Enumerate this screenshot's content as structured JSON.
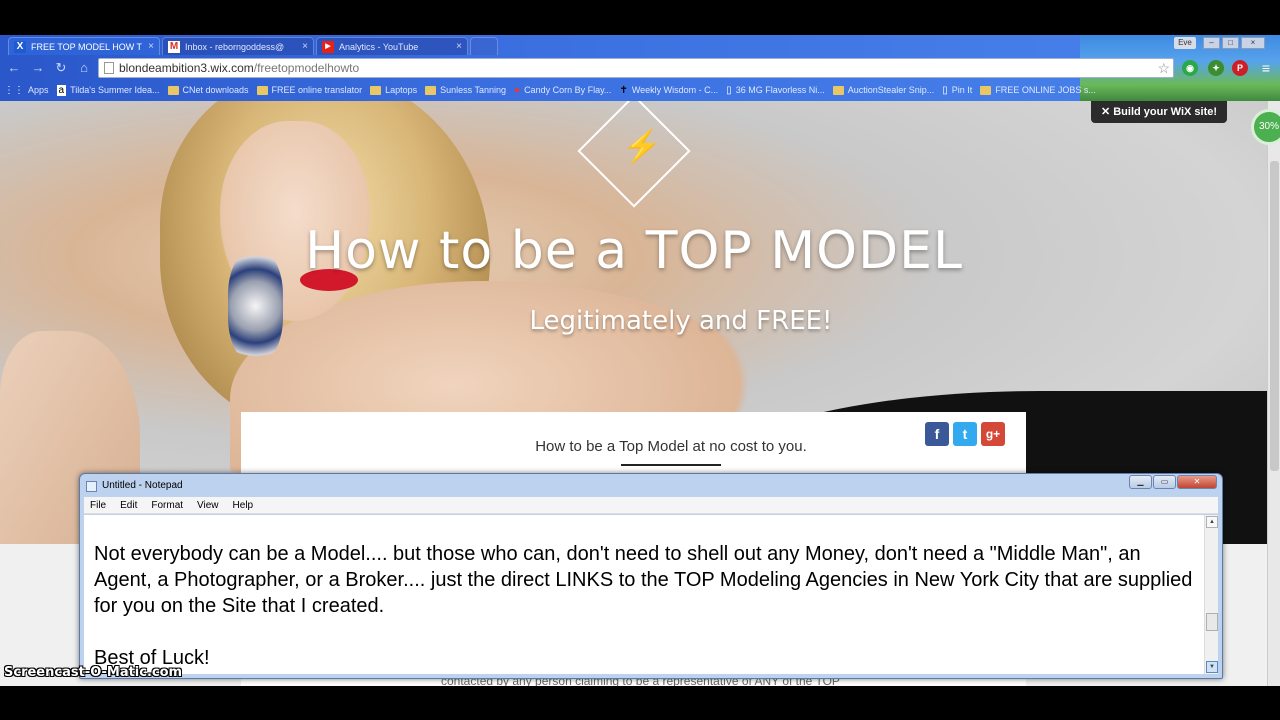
{
  "browser": {
    "tabs": [
      {
        "label": "FREE TOP MODEL HOW T",
        "icon": "wix-icon",
        "active": true
      },
      {
        "label": "Inbox - reborngoddess@",
        "icon": "gmail-icon",
        "active": false
      },
      {
        "label": "Analytics - YouTube",
        "icon": "youtube-icon",
        "active": false
      }
    ],
    "user_label": "Eve",
    "url_host": "blondeambition3.wix.com",
    "url_path": "/freetopmodelhowto",
    "bookmarks": [
      {
        "label": "Apps",
        "icon": "apps-grid-icon"
      },
      {
        "label": "Tilda's Summer Idea...",
        "icon": "amazon-icon"
      },
      {
        "label": "CNet downloads",
        "icon": "folder-icon"
      },
      {
        "label": "FREE online translator",
        "icon": "folder-icon"
      },
      {
        "label": "Laptops",
        "icon": "folder-icon"
      },
      {
        "label": "Sunless Tanning",
        "icon": "folder-icon"
      },
      {
        "label": "Candy Corn By Flay...",
        "icon": "red-badge-icon"
      },
      {
        "label": "Weekly Wisdom - C...",
        "icon": "cross-icon"
      },
      {
        "label": "36 MG Flavorless Ni...",
        "icon": "page-icon"
      },
      {
        "label": "AuctionStealer Snip...",
        "icon": "folder-icon"
      },
      {
        "label": "Pin It",
        "icon": "page-icon"
      },
      {
        "label": "FREE ONLINE JOBS s...",
        "icon": "folder-icon"
      }
    ]
  },
  "site": {
    "title": "How to be a TOP MODEL",
    "subtitle": "Legitimately and FREE!",
    "content_heading": "How to be a Top Model at no cost to you.",
    "below_text": "contacted by any person claiming to be a representative of ANY of the TOP",
    "wix_banner": "Build your WiX site!",
    "zoom_badge": "30%"
  },
  "notepad": {
    "title": "Untitled - Notepad",
    "menu": [
      "File",
      "Edit",
      "Format",
      "View",
      "Help"
    ],
    "paragraph": "Not everybody can be a Model.... but those who can, don't need to shell out any Money, don't need a \"Middle Man\", an Agent, a Photographer, or a Broker.... just the direct LINKS to the TOP Modeling Agencies in New York City that are supplied for you on the Site that I created.",
    "closing": "Best of Luck!"
  },
  "watermark": "Screencast-O-Matic.com",
  "colors": {
    "chrome_blue": "#2f63d8",
    "facebook": "#3b5998",
    "twitter": "#33aaf0",
    "google_plus": "#d34836",
    "lips_red": "#d2182b"
  }
}
